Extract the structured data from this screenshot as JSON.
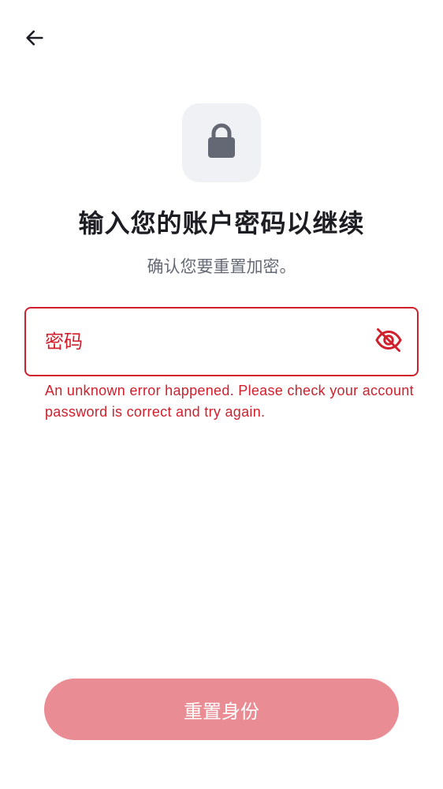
{
  "nav": {
    "back_icon": "arrow-left-icon"
  },
  "header": {
    "icon": "lock-icon",
    "title": "输入您的账户密码以继续",
    "subtitle": "确认您要重置加密。"
  },
  "password_field": {
    "placeholder": "密码",
    "value": "",
    "toggle_icon": "eye-off-icon",
    "error": "An unknown error happened. Please check your account password is correct and try again."
  },
  "submit": {
    "label": "重置身份",
    "enabled": false
  },
  "colors": {
    "error": "#d0202d",
    "button_disabled": "#ea8c93",
    "icon_tile": "#f0f1f4",
    "title": "#1c1d22",
    "subtitle": "#656a76"
  }
}
